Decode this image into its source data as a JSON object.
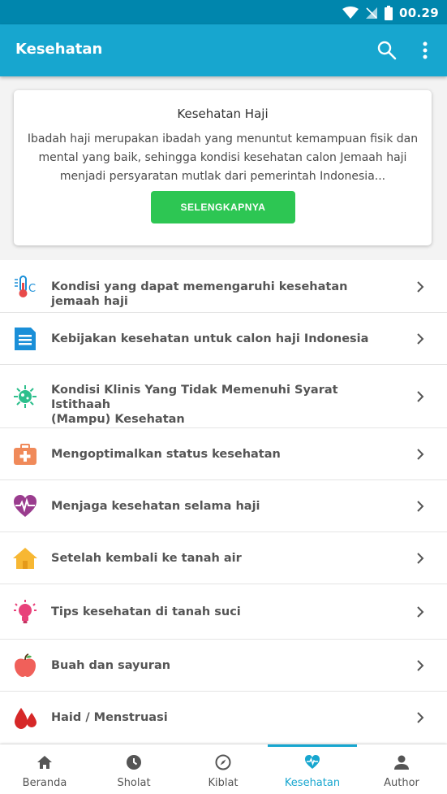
{
  "status_bar": {
    "time": "00.29",
    "icons": [
      "wifi-icon",
      "signal-off-icon",
      "battery-icon"
    ]
  },
  "app_bar": {
    "title": "Kesehatan",
    "icons": [
      "search-icon",
      "more-vert-icon"
    ]
  },
  "info_card": {
    "title": "Kesehatan Haji",
    "lines": [
      "Ibadah haji merupakan ibadah yang menuntut kemampuan fisik dan",
      "mental yang baik, sehingga kondisi kesehatan calon Jemaah haji",
      "menjadi persyaratan mutlak dari pemerintah Indonesia..."
    ],
    "button_label": "SELENGKAPNYA",
    "button_color": "#2dc653"
  },
  "menu": {
    "items": [
      {
        "icon": "thermometer-icon",
        "label_lines": [
          "Kondisi yang dapat memengaruhi kesehatan jemaah haji"
        ]
      },
      {
        "icon": "document-icon",
        "label_lines": [
          "Kebijakan kesehatan untuk calon haji Indonesia"
        ]
      },
      {
        "icon": "virus-icon",
        "label_lines": [
          "Kondisi Klinis Yang Tidak Memenuhi Syarat Istithaah",
          "(Mampu) Kesehatan"
        ]
      },
      {
        "icon": "first-aid-kit-icon",
        "label_lines": [
          "Mengoptimalkan status kesehatan"
        ]
      },
      {
        "icon": "heart-pulse-icon",
        "label_lines": [
          "Menjaga kesehatan selama haji"
        ]
      },
      {
        "icon": "house-icon",
        "label_lines": [
          "Setelah kembali ke tanah air"
        ]
      },
      {
        "icon": "lightbulb-icon",
        "label_lines": [
          "Tips kesehatan di tanah suci"
        ]
      },
      {
        "icon": "apple-icon",
        "label_lines": [
          "Buah dan sayuran"
        ]
      },
      {
        "icon": "blood-drops-icon",
        "label_lines": [
          "Haid / Menstruasi"
        ]
      }
    ]
  },
  "bottom_nav": {
    "items": [
      {
        "icon": "home-icon",
        "label": "Beranda"
      },
      {
        "icon": "clock-icon",
        "label": "Sholat"
      },
      {
        "icon": "compass-icon",
        "label": "Kiblat"
      },
      {
        "icon": "health-icon",
        "label": "Kesehatan",
        "active": true
      },
      {
        "icon": "person-icon",
        "label": "Author"
      }
    ],
    "active_color": "#17a6cf"
  },
  "colors": {
    "status_bar": "#0086ad",
    "app_bar": "#17a6cf",
    "accent": "#17a6cf"
  }
}
